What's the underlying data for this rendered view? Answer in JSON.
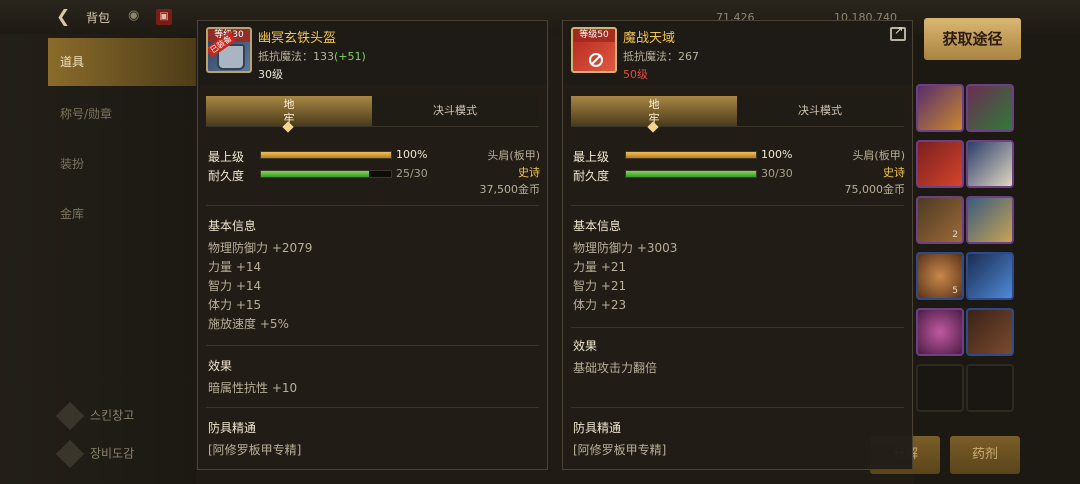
{
  "background": {
    "title": "背包",
    "stats": [
      "71,426",
      "10,180,740"
    ],
    "sidebar": [
      "道具",
      "称号/勋章",
      "装扮",
      "金库"
    ],
    "sidebar_bottom": [
      "스킨창고",
      "장비도감"
    ],
    "source_button": "获取途径",
    "bottom_buttons": [
      "分解",
      "药剂"
    ],
    "tile_counts": [
      "2",
      "5"
    ]
  },
  "left_item": {
    "icon_level": "等级30",
    "stamp": "已装备",
    "name": "幽冥玄铁头盔",
    "resist_label": "抵抗魔法：133",
    "resist_bonus": "(+51)",
    "level": "30级",
    "tab_active": "地\n牢",
    "tab_other": "决斗模式",
    "top_label": "最上级",
    "top_value": "100%",
    "top_fill": 1.0,
    "dur_label": "耐久度",
    "dur_value": "25/30",
    "dur_fill": 0.833,
    "slot": "头肩(板甲)",
    "rarity": "史诗",
    "price": "37,500金币",
    "basic_title": "基本信息",
    "basic_stats": [
      "物理防御力 +2079",
      "力量 +14",
      "智力 +14",
      "体力 +15",
      "施放速度 +5%"
    ],
    "effect_title": "效果",
    "effects": [
      "暗属性抗性 +10"
    ],
    "mastery_title": "防具精通",
    "mastery": "[阿修罗板甲专精]"
  },
  "right_item": {
    "icon_level": "等级50",
    "name": "魔战天域",
    "resist_label": "抵抗魔法：267",
    "level": "50级",
    "tab_active": "地\n牢",
    "tab_other": "决斗模式",
    "top_label": "最上级",
    "top_value": "100%",
    "top_fill": 1.0,
    "dur_label": "耐久度",
    "dur_value": "30/30",
    "dur_fill": 1.0,
    "slot": "头肩(板甲)",
    "rarity": "史诗",
    "price": "75,000金币",
    "basic_title": "基本信息",
    "basic_stats": [
      "物理防御力 +3003",
      "力量 +21",
      "智力 +21",
      "体力 +23"
    ],
    "effect_title": "效果",
    "effects": [
      "基础攻击力翻倍"
    ],
    "mastery_title": "防具精通",
    "mastery": "[阿修罗板甲专精]"
  }
}
